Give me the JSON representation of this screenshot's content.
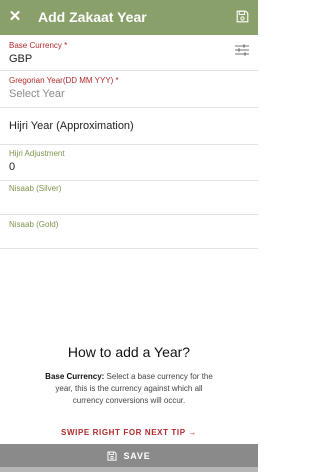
{
  "appbar": {
    "title": "Add Zakaat Year",
    "close_glyph": "✕",
    "close_icon": "close-icon",
    "save_icon": "save-icon"
  },
  "fields": {
    "base_currency": {
      "label": "Base Currency *",
      "value": "GBP"
    },
    "gregorian_year": {
      "label": "Gregorian Year(DD MM YYY) *",
      "placeholder": "Select Year"
    },
    "hijri_year": {
      "placeholder": "Hijri Year (Approximation)"
    },
    "hijri_adjustment": {
      "label": "Hijri Adjustment",
      "value": "0"
    },
    "nisaab_silver": {
      "label": "Nisaab (Silver)",
      "value": ""
    },
    "nisaab_gold": {
      "label": "Nisaab (Gold)",
      "value": ""
    }
  },
  "howto": {
    "title": "How to add a Year?",
    "lead": "Base Currency:",
    "text": " Select a base currency for the year, this is the currency against which all currency conversions will occur."
  },
  "tip": {
    "label": "SWIPE RIGHT FOR NEXT TIP",
    "arrow": "→"
  },
  "savebar": {
    "label": "SAVE"
  },
  "colors": {
    "appbar": "#8aa06a",
    "accent_red": "#b02a2a",
    "accent_olive": "#7e944e",
    "save_bar": "#8a8a8a"
  }
}
